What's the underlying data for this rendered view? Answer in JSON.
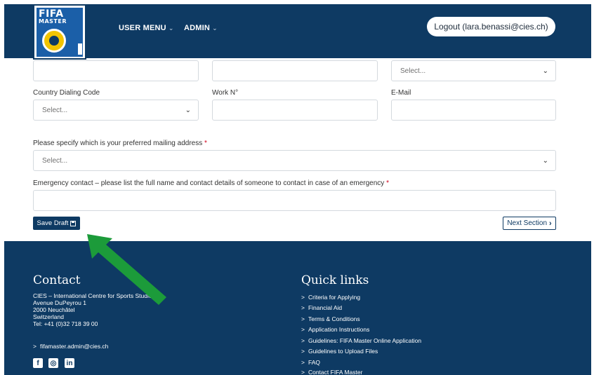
{
  "header": {
    "logo": {
      "line1": "FIFA",
      "line2": "MASTER"
    },
    "nav": [
      {
        "label": "USER MENU",
        "chevron": "chevron-down-icon"
      },
      {
        "label": "ADMIN",
        "chevron": "chevron-down-icon"
      }
    ],
    "logout_label": "Logout (lara.benassi@cies.ch)"
  },
  "form": {
    "top_row_select_placeholder": "Select...",
    "labels": {
      "country_dialing_code": "Country Dialing Code",
      "work_no": "Work N°",
      "email": "E-Mail",
      "mailing_address": "Please specify which is your preferred mailing address",
      "emergency_contact": "Emergency contact – please list the full name and contact details of someone to contact in case of an emergency",
      "required_marker": "*"
    },
    "country_dialing_code_placeholder": "Select...",
    "mailing_address_placeholder": "Select...",
    "save_draft_label": "Save Draft",
    "next_section_label": "Next Section"
  },
  "footer": {
    "contact": {
      "title": "Contact",
      "lines": [
        "CIES – International Centre for Sports Studies",
        "Avenue DuPeyrou 1",
        "2000 Neuchâtel",
        "Switzerland",
        "Tel: +41 (0)32 718 39 00"
      ],
      "email_link": "fifamaster.admin@cies.ch",
      "social": [
        "f",
        "◎",
        "in"
      ]
    },
    "quick_links": {
      "title": "Quick links",
      "items": [
        "Criteria for Applying",
        "Financial Aid",
        "Terms & Conditions",
        "Application Instructions",
        "Guidelines: FIFA Master Online Application",
        "Guidelines to Upload Files",
        "FAQ",
        "Contact FIFA Master"
      ]
    }
  },
  "colors": {
    "navy": "#0e3a63",
    "arrow_green": "#1c9b3a",
    "required_red": "#d0021b"
  }
}
